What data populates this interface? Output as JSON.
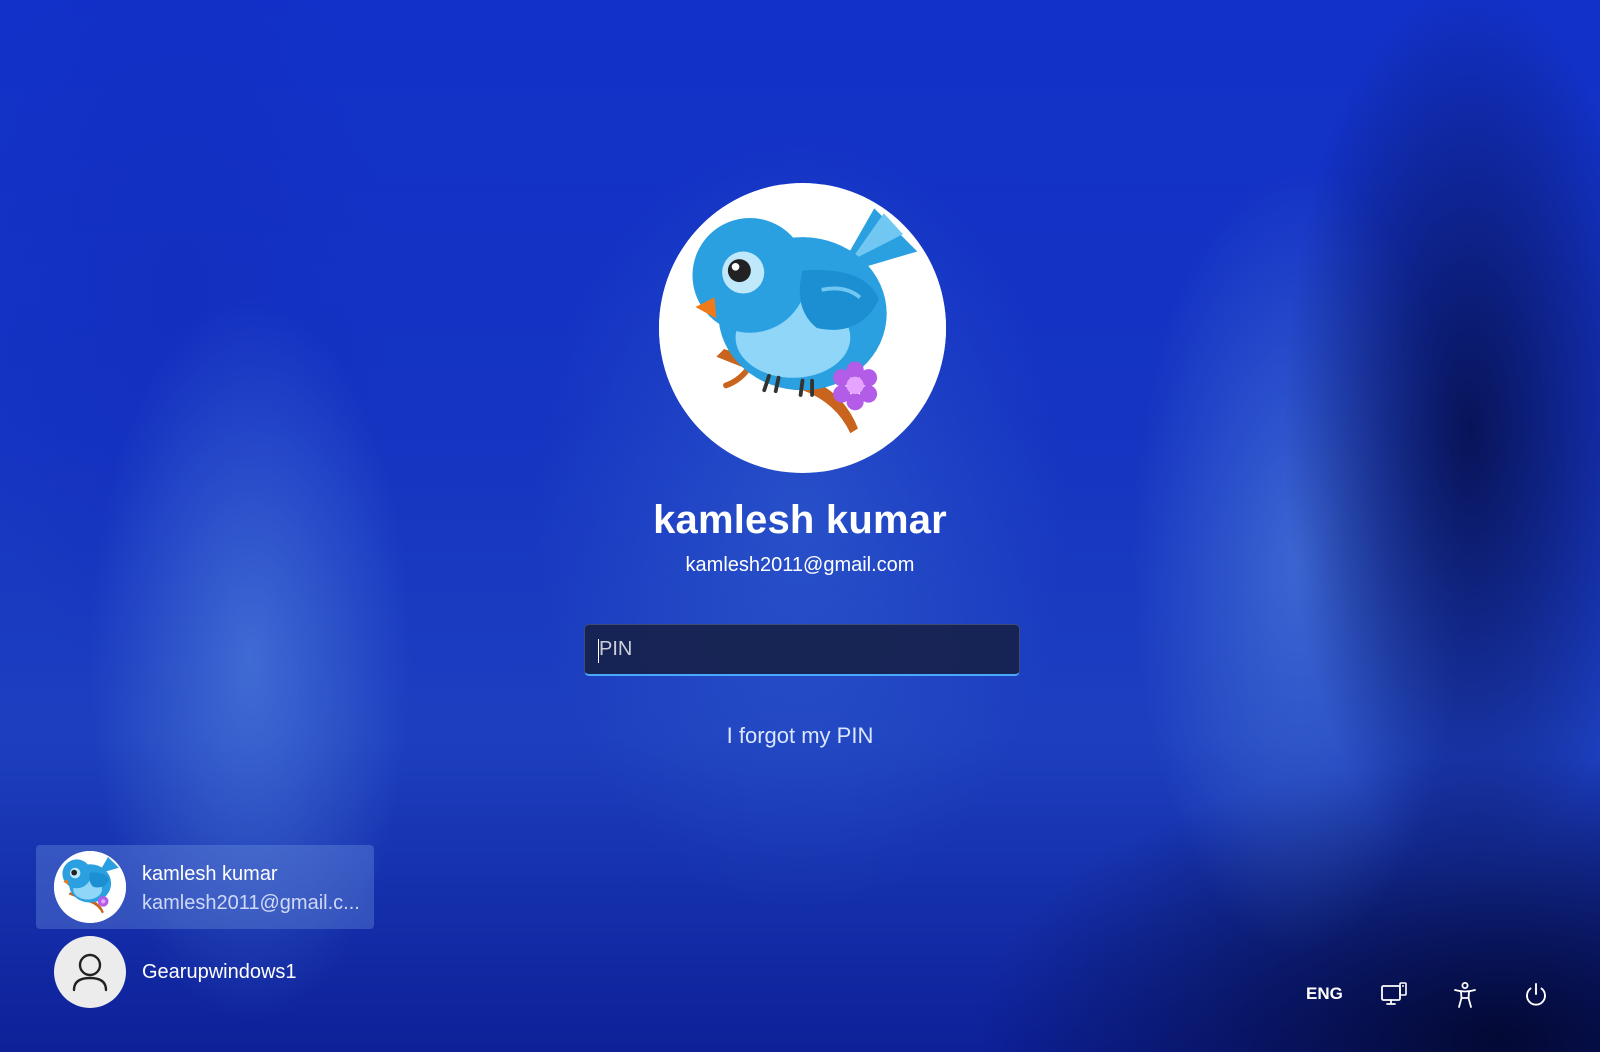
{
  "account": {
    "name": "kamlesh kumar",
    "email": "kamlesh2011@gmail.com"
  },
  "pin_field": {
    "placeholder": "PIN",
    "value": ""
  },
  "forgot_pin_label": "I forgot my PIN",
  "user_list": [
    {
      "name": "kamlesh kumar",
      "email": "kamlesh2011@gmail.c...",
      "avatar": "bird-avatar",
      "selected": true
    },
    {
      "name": "Gearupwindows1",
      "avatar": "person-icon",
      "selected": false
    }
  ],
  "tray": {
    "language": "ENG",
    "icons": [
      "network-icon",
      "accessibility-icon",
      "power-icon"
    ]
  },
  "colors": {
    "accent": "#4aa8ff",
    "background": "#1436c6",
    "bird_blue": "#2aa0e0",
    "flower_purple": "#b35ce8"
  }
}
